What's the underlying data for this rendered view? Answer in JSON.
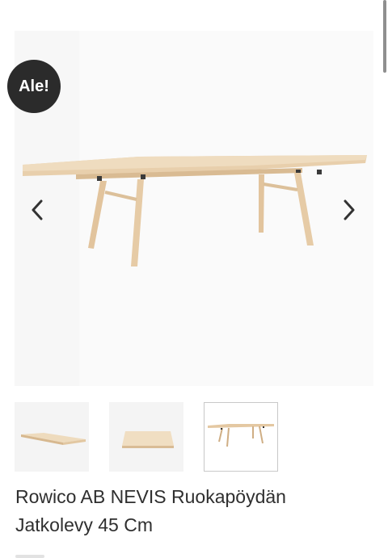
{
  "badge": {
    "label": "Ale!"
  },
  "product": {
    "title_line1": "Rowico AB NEVIS Ruokapöydän",
    "title_line2": "Jatkolevy 45 Cm"
  },
  "gallery": {
    "main_image": "extendable-dining-table",
    "prev_icon": "chevron-left-icon",
    "next_icon": "chevron-right-icon",
    "thumbnails": [
      {
        "image": "extension-leaf-angled",
        "selected": false
      },
      {
        "image": "extension-leaf-flat",
        "selected": false
      },
      {
        "image": "extended-dining-table",
        "selected": true
      }
    ]
  },
  "colors": {
    "badge_bg": "#2b2b2b",
    "wood": "#e6cba6",
    "wood_dark": "#cfae84",
    "title_text": "#2f2f2f"
  }
}
